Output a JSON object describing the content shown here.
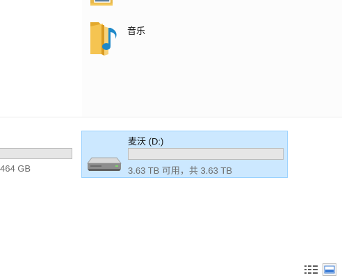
{
  "folders": [
    {
      "icon": "folder-icon"
    },
    {
      "label": "音乐",
      "icon": "music-folder-icon"
    }
  ],
  "drives": [
    {
      "size_text": "464 GB",
      "icon": "drive-icon"
    },
    {
      "name": "麦沃 (D:)",
      "free_text": "3.63 TB 可用，共 3.63 TB",
      "used_fraction": 0.0,
      "selected": true,
      "icon": "hard-drive-icon"
    }
  ],
  "view_buttons": [
    {
      "icon": "details-view-icon"
    },
    {
      "icon": "large-icons-view-icon"
    }
  ],
  "colors": {
    "selection_bg": "#cce8ff",
    "selection_border": "#99d1ff",
    "bar_bg": "#e6e6e6",
    "bar_fill": "#26a0da",
    "secondary_text": "#6d6d6d"
  }
}
